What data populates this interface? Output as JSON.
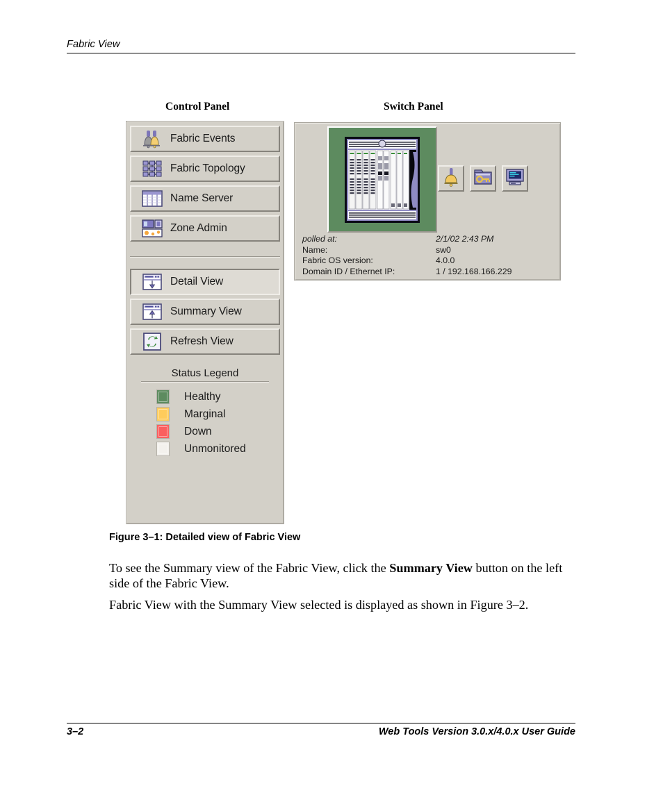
{
  "header": {
    "title": "Fabric View"
  },
  "figure": {
    "control_panel_title": "Control Panel",
    "switch_panel_title": "Switch Panel",
    "caption": "Figure 3–1:  Detailed view of Fabric View"
  },
  "control_panel": {
    "buttons": [
      {
        "label": "Fabric Events",
        "icon": "two-bells-icon",
        "selected": false
      },
      {
        "label": "Fabric Topology",
        "icon": "node-grid-icon",
        "selected": false
      },
      {
        "label": "Name Server",
        "icon": "table-grid-icon",
        "selected": false
      },
      {
        "label": "Zone Admin",
        "icon": "zone-panels-icon",
        "selected": false
      }
    ],
    "view_buttons": [
      {
        "label": "Detail View",
        "icon": "window-down-arrow-icon",
        "selected": true
      },
      {
        "label": "Summary View",
        "icon": "window-up-arrow-icon",
        "selected": false
      },
      {
        "label": "Refresh View",
        "icon": "refresh-arrows-icon",
        "selected": false
      }
    ],
    "status_legend": {
      "title": "Status Legend",
      "items": [
        {
          "label": "Healthy",
          "color": "#5d8b5f"
        },
        {
          "label": "Marginal",
          "color": "#ffcc5c"
        },
        {
          "label": "Down",
          "color": "#fa5f5f"
        },
        {
          "label": "Unmonitored",
          "color": "#f3f1ed"
        }
      ]
    }
  },
  "switch_panel": {
    "switch_status_color": "#5d8b5f",
    "icons": [
      {
        "name": "switch-events-bell-icon"
      },
      {
        "name": "admin-key-folder-icon"
      },
      {
        "name": "telnet-monitor-icon"
      }
    ],
    "info": [
      {
        "key": "polled at:",
        "value": "2/1/02 2:43 PM",
        "italic": true
      },
      {
        "key": "Name:",
        "value": "sw0",
        "italic": false
      },
      {
        "key": "Fabric OS version:",
        "value": "4.0.0",
        "italic": false
      },
      {
        "key": "Domain ID / Ethernet IP:",
        "value": "1 / 192.168.166.229",
        "italic": false
      }
    ]
  },
  "body": {
    "para1_before": "To see the Summary view of the Fabric View, click the ",
    "para1_bold": "Summary View",
    "para1_after": " button on the left side of the Fabric View.",
    "para2": "Fabric View with the Summary View selected is displayed as shown in Figure 3–2."
  },
  "footer": {
    "page_number": "3–2",
    "guide_title": "Web Tools Version 3.0.x/4.0.x User Guide"
  }
}
